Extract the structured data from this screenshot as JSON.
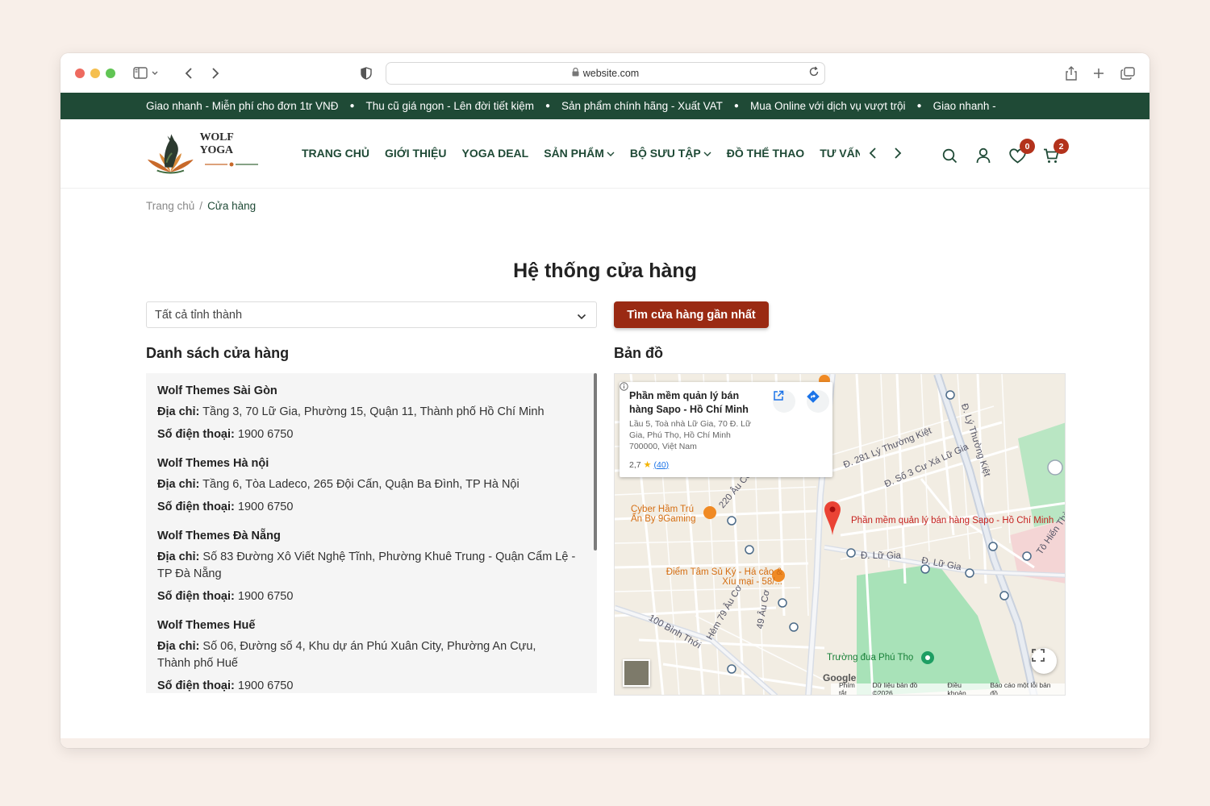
{
  "browser": {
    "url": "website.com"
  },
  "announcement": {
    "messages": [
      "Giao nhanh - Miễn phí cho đơn 1tr VNĐ",
      "Thu cũ giá ngon - Lên đời tiết kiệm",
      "Sản phẩm chính hãng - Xuất VAT",
      "Mua Online với dịch vụ vượt trội",
      "Giao nhanh -"
    ]
  },
  "header": {
    "logo_text": "WOLF YOGA",
    "nav": [
      {
        "label": "TRANG CHỦ",
        "has_dropdown": false
      },
      {
        "label": "GIỚI THIỆU",
        "has_dropdown": false
      },
      {
        "label": "YOGA DEAL",
        "has_dropdown": false
      },
      {
        "label": "SẢN PHẨM",
        "has_dropdown": true
      },
      {
        "label": "BỘ SƯU TẬP",
        "has_dropdown": true
      },
      {
        "label": "ĐỒ THỂ THAO",
        "has_dropdown": false
      },
      {
        "label": "TƯ VẤN",
        "has_dropdown": false
      }
    ],
    "wishlist_count": "0",
    "cart_count": "2"
  },
  "breadcrumb": {
    "home": "Trang chủ",
    "separator": "/",
    "current": "Cửa hàng"
  },
  "page": {
    "title": "Hệ thống cửa hàng",
    "province_select_value": "Tất cả tỉnh thành",
    "find_button": "Tìm cửa hàng gần nhất",
    "list_title": "Danh sách cửa hàng",
    "map_title": "Bản đồ"
  },
  "stores": [
    {
      "name": "Wolf Themes Sài Gòn",
      "address_label": "Địa chỉ:",
      "address": "Tầng 3, 70 Lữ Gia, Phường 15, Quận 11, Thành phố Hồ Chí Minh",
      "phone_label": "Số điện thoại:",
      "phone": "1900 6750"
    },
    {
      "name": "Wolf Themes Hà nội",
      "address_label": "Địa chỉ:",
      "address": "Tầng 6, Tòa Ladeco, 265 Đội Cấn, Quận Ba Đình, TP Hà Nội",
      "phone_label": "Số điện thoại:",
      "phone": "1900 6750"
    },
    {
      "name": "Wolf Themes Đà Nẵng",
      "address_label": "Địa chỉ:",
      "address": "Số 83 Đường Xô Viết Nghệ Tĩnh, Phường Khuê Trung - Quận Cẩm Lệ - TP Đà Nẵng",
      "phone_label": "Số điện thoại:",
      "phone": "1900 6750"
    },
    {
      "name": "Wolf Themes Huế",
      "address_label": "Địa chỉ:",
      "address": "Số 06, Đường số 4, Khu dự án Phú Xuân City, Phường An Cựu, Thành phố Huế",
      "phone_label": "Số điện thoại:",
      "phone": "1900 6750"
    }
  ],
  "map": {
    "card": {
      "title": "Phần mềm quản lý bán hàng Sapo - Hồ Chí Minh",
      "address": "Lầu 5, Toà nhà Lữ Gia, 70 Đ. Lữ Gia, Phú Thọ, Hồ Chí Minh 700000, Việt Nam",
      "rating": "2,7",
      "reviews": "(40)"
    },
    "pin_label": "Phần mềm quản lý bán hàng Sapo - Hồ Chí Minh",
    "places": [
      "Cyber Hầm Trú Ẩn By 9Gaming",
      "Điểm Tâm Sủ Ký - Há cảo & Xíu mại - 58/...",
      "Trường đua Phú Thọ"
    ],
    "streets": [
      "Đ. 281 Lý Thường Kiệt",
      "Đ. Lý Thường Kiệt",
      "Đ. Lữ Gia",
      "Đ. Lữ Gia",
      "100 Bình Thới",
      "Đ. Số 3 Cư Xá Lữ Gia",
      "Tô Hiến Thành",
      "Hẻm 79 Âu Cơ",
      "49 Âu Cơ",
      "220 Âu Cơ"
    ],
    "google": "Google",
    "footer": [
      "Phím tắt",
      "Dữ liệu bản đồ ©2026",
      "Điều khoản",
      "Báo cáo một lỗi bản đồ"
    ]
  },
  "colors": {
    "announcement_bg": "#1f4a36",
    "nav_text": "#1f4a36",
    "accent_button": "#9a2a13",
    "badge": "#b3321c",
    "page_bg": "#f8efe9"
  }
}
